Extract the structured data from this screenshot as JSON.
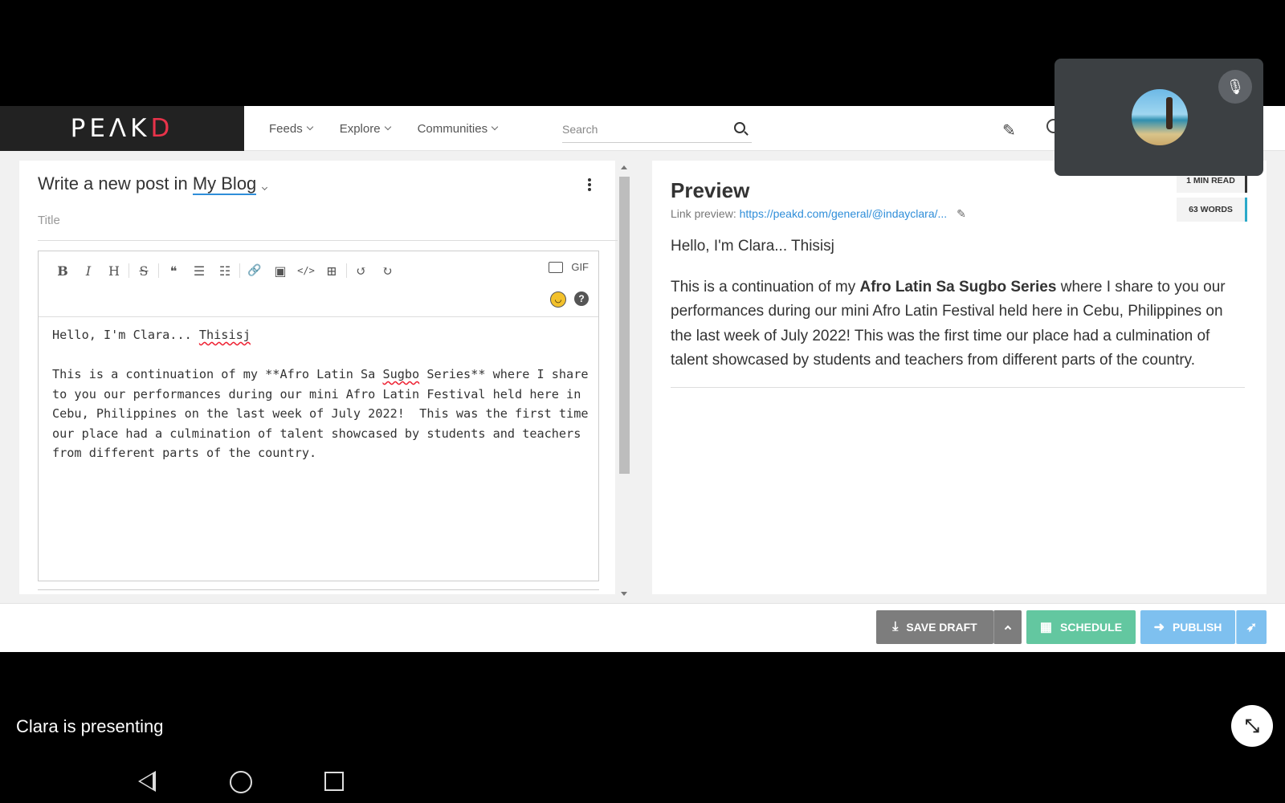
{
  "header": {
    "logo": "PEAKD",
    "nav": [
      {
        "label": "Feeds"
      },
      {
        "label": "Explore"
      },
      {
        "label": "Communities"
      }
    ],
    "search_placeholder": "Search"
  },
  "editor": {
    "heading_prefix": "Write a new post in",
    "community": "My Blog",
    "title_placeholder": "Title",
    "toolbar": {
      "bold": "B",
      "italic": "I",
      "heading": "H",
      "strike": "S",
      "quote": "❝",
      "ordered_list": "☰",
      "bullet_list": "☷",
      "link": "🔗",
      "image": "▣",
      "code": "</>",
      "table": "⊞",
      "undo": "↺",
      "redo": "↻",
      "gif": "GIF"
    },
    "content_line1_a": "Hello, I'm Clara... ",
    "content_line1_b": "Thisisj",
    "content_p2_a": "This is a continuation of my **Afro Latin Sa ",
    "content_p2_b": "Sugbo",
    "content_p2_c": " Series** where I share to you our performances during our mini Afro Latin Festival held here in Cebu, Philippines on the last week of July 2022!  This was the first time our place had a culmination of talent showcased by students and teachers from different parts of the country."
  },
  "preview": {
    "title": "Preview",
    "link_label": "Link preview:",
    "link_url": "https://peakd.com/general/@indayclara/...",
    "read_time": "1 MIN READ",
    "word_count": "63 WORDS",
    "p1": "Hello, I'm Clara... Thisisj",
    "p2_a": "This is a continuation of my ",
    "p2_bold": "Afro Latin Sa Sugbo Series",
    "p2_b": " where I share to you our performances during our mini Afro Latin Festival held here in Cebu, Philippines on the last week of July 2022! This was the first time our place had a culmination of talent showcased by students and teachers from different parts of the country."
  },
  "actions": {
    "save_draft": "SAVE DRAFT",
    "schedule": "SCHEDULE",
    "publish": "PUBLISH"
  },
  "meeting": {
    "presenting_text": "Clara is presenting"
  }
}
